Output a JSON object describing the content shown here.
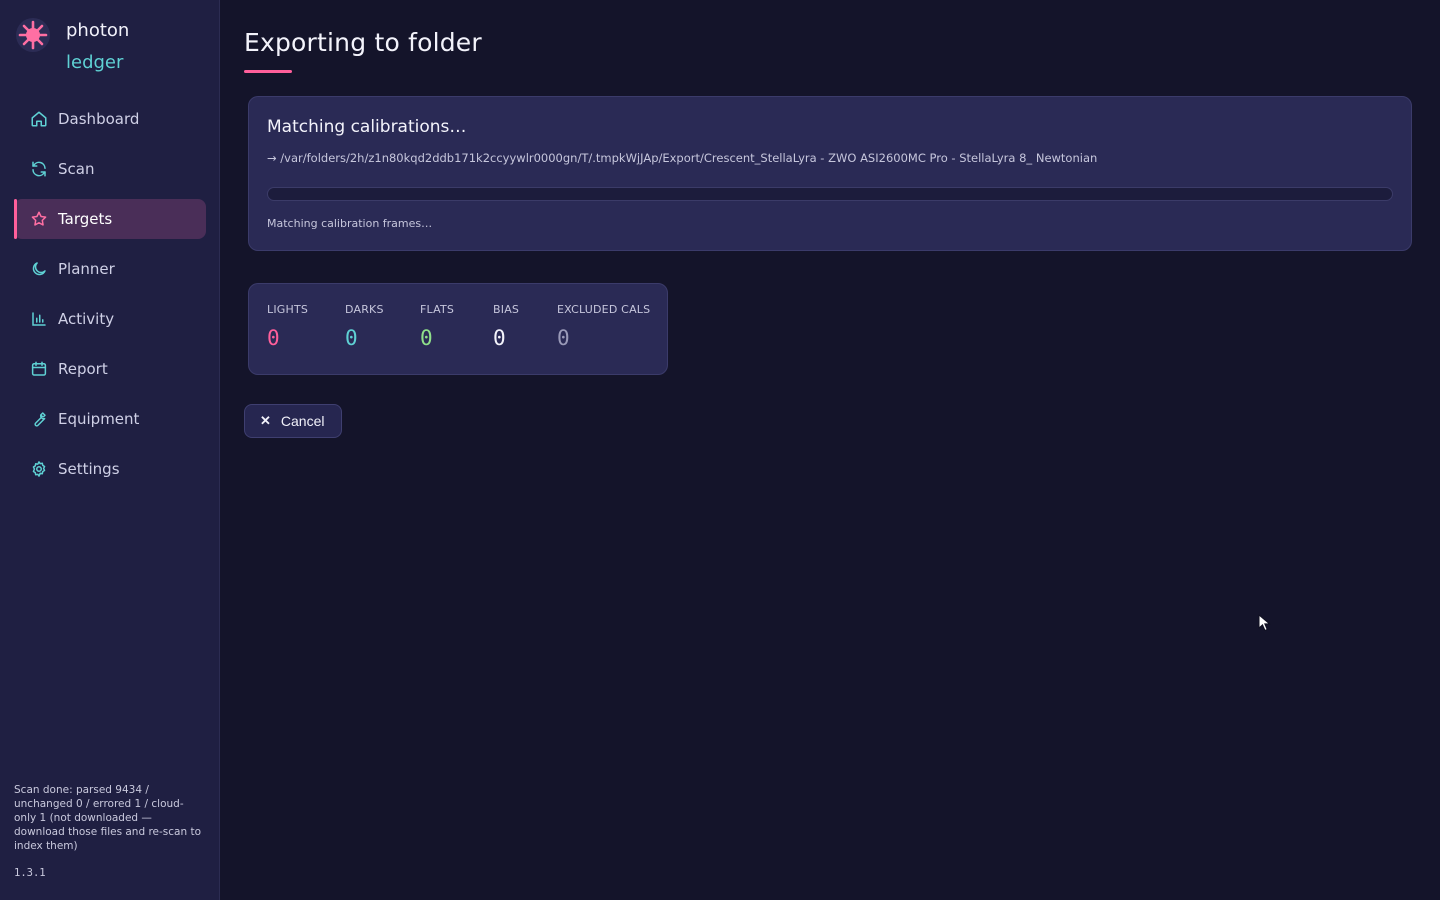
{
  "brand": {
    "line1": "photon",
    "line2": "ledger"
  },
  "nav": [
    {
      "label": "Dashboard",
      "icon": "home-icon",
      "active": false
    },
    {
      "label": "Scan",
      "icon": "refresh-icon",
      "active": false
    },
    {
      "label": "Targets",
      "icon": "star-icon",
      "active": true
    },
    {
      "label": "Planner",
      "icon": "moon-icon",
      "active": false
    },
    {
      "label": "Activity",
      "icon": "bar-chart-icon",
      "active": false
    },
    {
      "label": "Report",
      "icon": "calendar-icon",
      "active": false
    },
    {
      "label": "Equipment",
      "icon": "wrench-icon",
      "active": false
    },
    {
      "label": "Settings",
      "icon": "gear-icon",
      "active": false
    }
  ],
  "sidebar_status": "Scan done: parsed 9434 / unchanged 0 / errored 1 / cloud-only 1 (not downloaded — download those files and re-scan to index them)",
  "version": "1.3.1",
  "page": {
    "title": "Exporting to folder"
  },
  "progress": {
    "title": "Matching calibrations…",
    "path": "→ /var/folders/2h/z1n80kqd2ddb171k2ccyywlr0000gn/T/.tmpkWjJAp/Export/Crescent_StellaLyra - ZWO ASI2600MC Pro - StellaLyra 8_ Newtonian",
    "fraction": 0,
    "subtext": "Matching calibration frames…"
  },
  "stats": [
    {
      "label": "LIGHTS",
      "value": "0",
      "color": "#ff5f9b"
    },
    {
      "label": "DARKS",
      "value": "0",
      "color": "#5fd1d4"
    },
    {
      "label": "FLATS",
      "value": "0",
      "color": "#8fe08a"
    },
    {
      "label": "BIAS",
      "value": "0",
      "color": "#f3f3fb"
    },
    {
      "label": "EXCLUDED CALS",
      "value": "0",
      "color": "#9a9ab8"
    }
  ],
  "actions": {
    "cancel_label": "Cancel"
  },
  "colors": {
    "accent": "#ff5f9b",
    "teal": "#5fd1d4",
    "background": "#14142a",
    "sidebar": "#1f1f42",
    "card": "#2a2a55"
  }
}
